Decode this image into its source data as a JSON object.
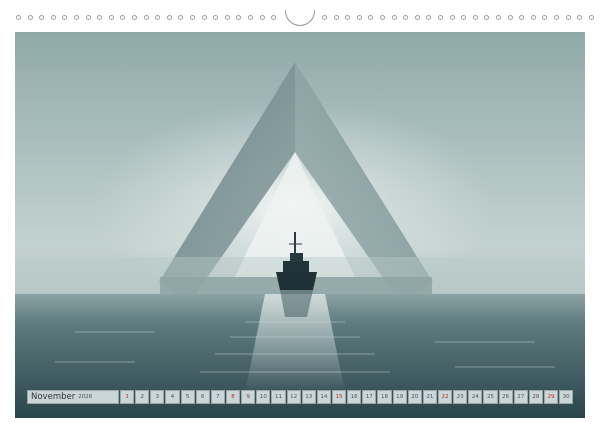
{
  "calendar": {
    "month": "November",
    "year": "2026",
    "days": [
      {
        "d": "1",
        "red": true
      },
      {
        "d": "2",
        "red": false
      },
      {
        "d": "3",
        "red": false
      },
      {
        "d": "4",
        "red": false
      },
      {
        "d": "5",
        "red": false
      },
      {
        "d": "6",
        "red": false
      },
      {
        "d": "7",
        "red": false
      },
      {
        "d": "8",
        "red": true
      },
      {
        "d": "9",
        "red": false
      },
      {
        "d": "10",
        "red": false
      },
      {
        "d": "11",
        "red": false
      },
      {
        "d": "12",
        "red": false
      },
      {
        "d": "13",
        "red": false
      },
      {
        "d": "14",
        "red": false
      },
      {
        "d": "15",
        "red": true
      },
      {
        "d": "16",
        "red": false
      },
      {
        "d": "17",
        "red": false
      },
      {
        "d": "18",
        "red": false
      },
      {
        "d": "19",
        "red": false
      },
      {
        "d": "20",
        "red": false
      },
      {
        "d": "21",
        "red": false
      },
      {
        "d": "22",
        "red": true
      },
      {
        "d": "23",
        "red": false
      },
      {
        "d": "24",
        "red": false
      },
      {
        "d": "25",
        "red": false
      },
      {
        "d": "26",
        "red": false
      },
      {
        "d": "27",
        "red": false
      },
      {
        "d": "28",
        "red": false
      },
      {
        "d": "29",
        "red": true
      },
      {
        "d": "30",
        "red": false
      }
    ]
  },
  "colors": {
    "sky": "#9fb6b5",
    "water": "#2f4a51",
    "sunday": "#c0272d"
  }
}
